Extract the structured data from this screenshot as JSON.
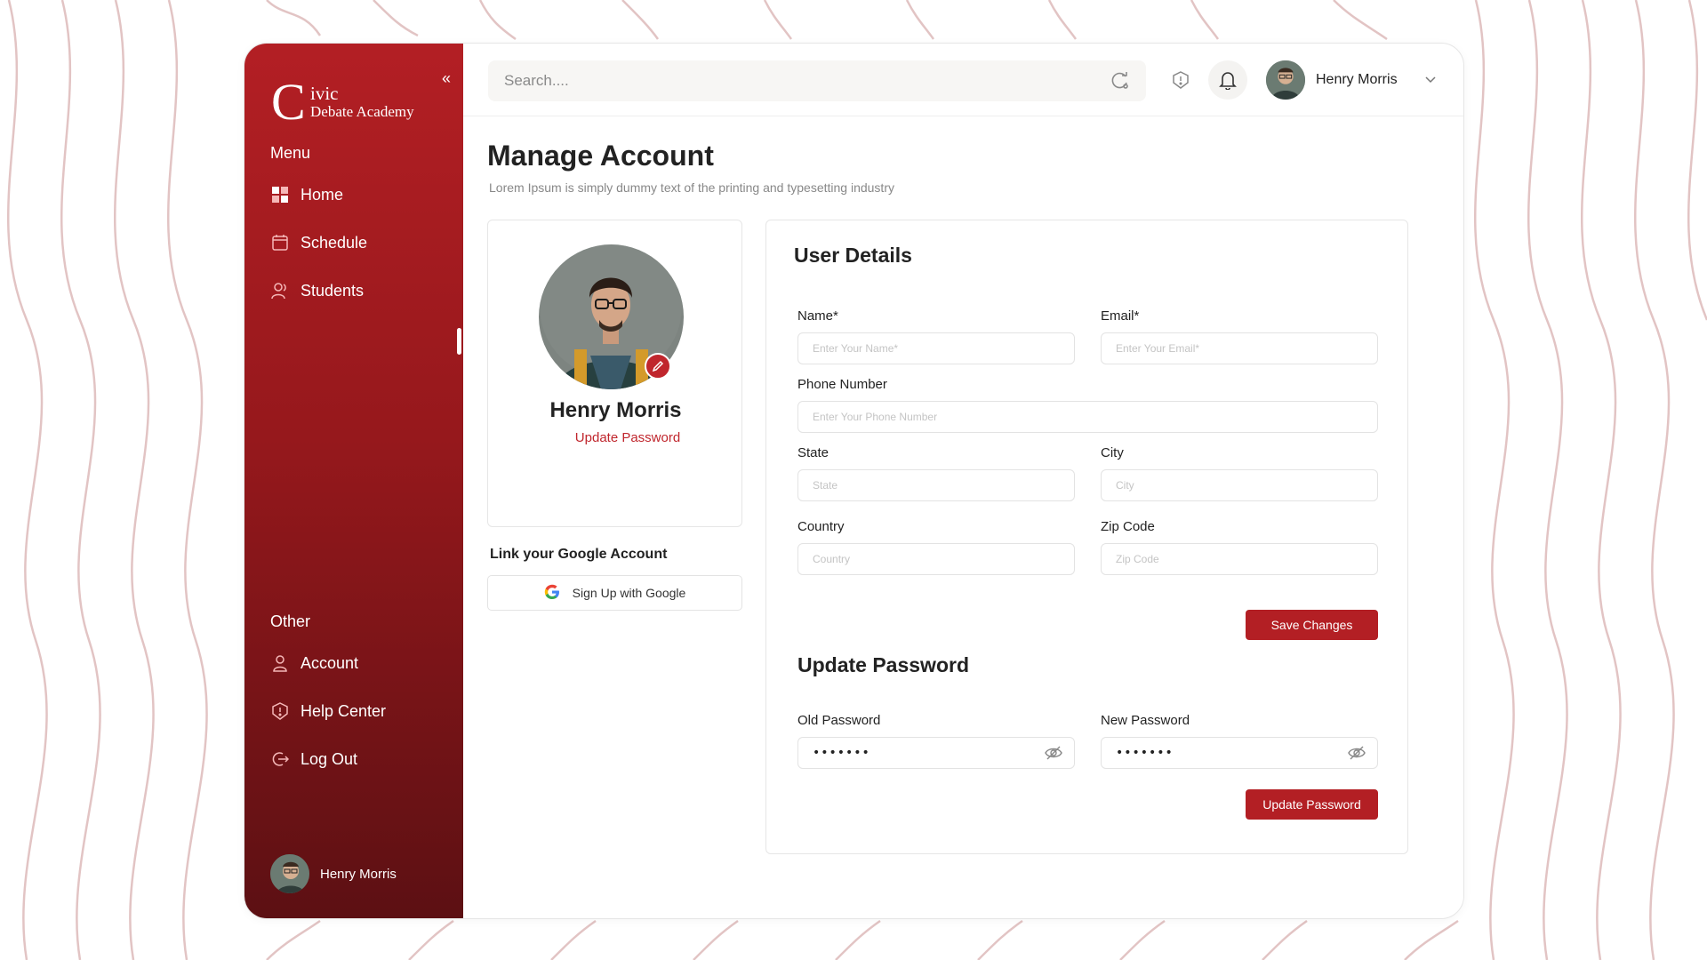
{
  "brand": {
    "logo_letter": "C",
    "logo_line1": "ivic",
    "logo_line2": "Debate Academy",
    "accent": "#b31f24"
  },
  "sidebar": {
    "collapse_icon": "chevrons-left-icon",
    "menu_heading": "Menu",
    "menu_items": [
      {
        "label": "Home",
        "icon": "grid-icon"
      },
      {
        "label": "Schedule",
        "icon": "calendar-icon"
      },
      {
        "label": "Students",
        "icon": "users-icon"
      }
    ],
    "other_heading": "Other",
    "other_items": [
      {
        "label": "Account",
        "icon": "user-icon"
      },
      {
        "label": "Help Center",
        "icon": "shield-icon"
      },
      {
        "label": "Log Out",
        "icon": "logout-icon"
      }
    ],
    "user_name": "Henry Morris"
  },
  "topbar": {
    "search_placeholder": "Search....",
    "user_name": "Henry Morris"
  },
  "page": {
    "title": "Manage Account",
    "subtitle": "Lorem Ipsum is simply dummy text of the printing and typesetting industry"
  },
  "profile": {
    "name": "Henry Morris",
    "update_password_link": "Update Password",
    "link_google_title": "Link your Google Account",
    "google_button": "Sign Up with Google"
  },
  "user_details": {
    "title": "User Details",
    "name_label": "Name*",
    "name_placeholder": "Enter Your Name*",
    "email_label": "Email*",
    "email_placeholder": "Enter Your Email*",
    "phone_label": "Phone Number",
    "phone_placeholder": "Enter Your Phone Number",
    "state_label": "State",
    "state_placeholder": "State",
    "city_label": "City",
    "city_placeholder": "City",
    "country_label": "Country",
    "country_placeholder": "Country",
    "zip_label": "Zip Code",
    "zip_placeholder": "Zip Code",
    "save_button": "Save Changes"
  },
  "update_password": {
    "title": "Update Password",
    "old_label": "Old Password",
    "old_value": "•••••••",
    "new_label": "New Password",
    "new_value": "•••••••",
    "button": "Update Password"
  }
}
